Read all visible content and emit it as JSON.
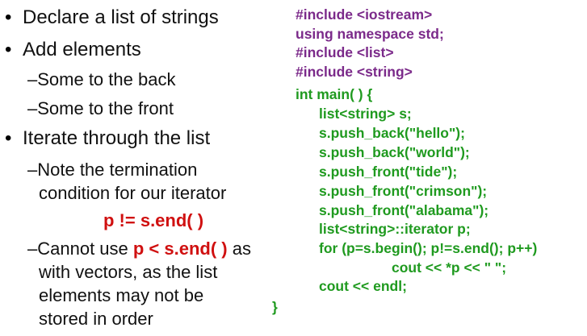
{
  "bullets": {
    "b1": "Declare a list of strings",
    "b2": "Add elements",
    "b2a": "–Some to the back",
    "b2b": "–Some to the front",
    "b3": "Iterate through the list",
    "b3a_line1": "–Note the termination",
    "b3a_line2": "condition for our iterator",
    "b3a_code": "p != s.end( )",
    "b3b_line1_pre": "–Cannot use ",
    "b3b_line1_code": "p < s.end( )",
    "b3b_line1_post": " as",
    "b3b_line2": "with vectors, as the list",
    "b3b_line3": "elements may not be",
    "b3b_line4": "stored in order",
    "bullet_char": "•"
  },
  "code": {
    "l1": "#include <iostream>",
    "l2": "using namespace std;",
    "l3": "#include <list>",
    "l4": "#include <string>",
    "l5": "int main( ) {",
    "l6": "list<string> s;",
    "l7": "s.push_back(\"hello\");",
    "l8": "s.push_back(\"world\");",
    "l9": "s.push_front(\"tide\");",
    "l10": "s.push_front(\"crimson\");",
    "l11": "s.push_front(\"alabama\");",
    "l12": "list<string>::iterator p;",
    "l13": "for (p=s.begin(); p!=s.end(); p++)",
    "l14": "cout << *p << \" \";",
    "l15": "cout << endl;",
    "l16": "}"
  },
  "colors": {
    "preprocessor": "#7b2a8a",
    "code": "#1f9a1f",
    "highlight": "#d01010",
    "text": "#111111"
  }
}
